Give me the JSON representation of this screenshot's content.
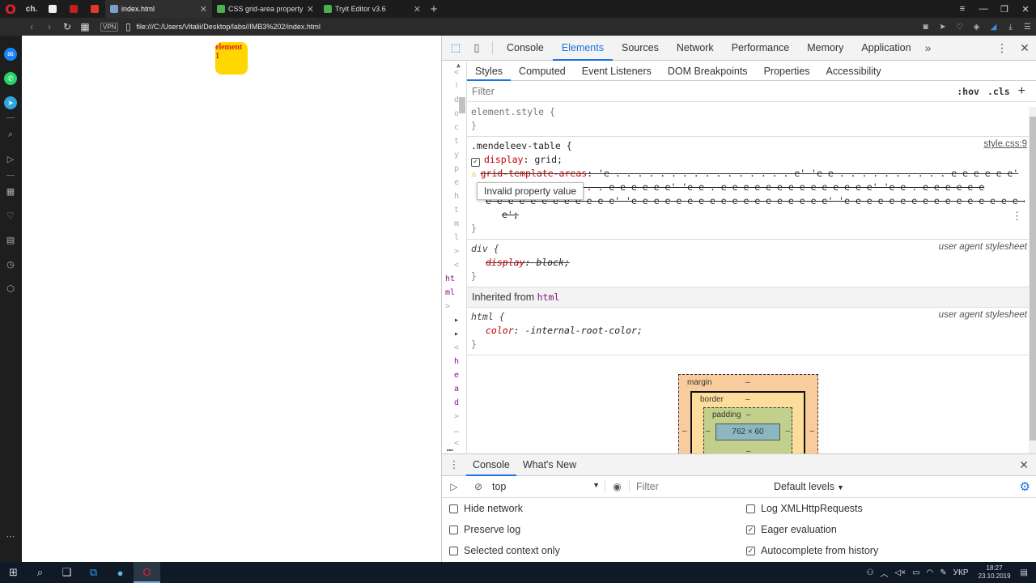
{
  "browser": {
    "pinned_tabs": [
      {
        "label": "ch."
      },
      {
        "label": ""
      },
      {
        "label": ""
      },
      {
        "label": ""
      }
    ],
    "tabs": [
      {
        "title": "index.html",
        "active": true,
        "favicon_color": "#7aa0c8"
      },
      {
        "title": "CSS grid-area property",
        "active": false,
        "favicon_color": "#4caf50"
      },
      {
        "title": "Tryit Editor v3.6",
        "active": false,
        "favicon_color": "#4caf50"
      }
    ],
    "vpn_label": "VPN",
    "url": "file:///C:/Users/Vitalii/Desktop/labs//IMB3%202/index.html"
  },
  "page": {
    "element_text": "element 1",
    "element_color": "#ffd700"
  },
  "devtools": {
    "tabs": [
      "Console",
      "Elements",
      "Sources",
      "Network",
      "Performance",
      "Memory",
      "Application"
    ],
    "active_tab": "Elements",
    "sub_tabs": [
      "Styles",
      "Computed",
      "Event Listeners",
      "DOM Breakpoints",
      "Properties",
      "Accessibility"
    ],
    "filter_placeholder": "Filter",
    "hov_label": ":hov",
    "cls_label": ".cls",
    "plus_label": "+",
    "left_gutter": {
      "chars": [
        "<",
        "!",
        "d",
        "o",
        "c",
        "t",
        "y",
        "p",
        "e",
        "h",
        "t",
        "m",
        "l",
        ">",
        "<"
      ],
      "html_lines": [
        "ht",
        "ml"
      ],
      "lower_chars": [
        ">",
        "▸",
        "▸",
        "<",
        "h",
        "e",
        "a",
        "d",
        ">"
      ],
      "bottom": [
        "…",
        "<",
        "/",
        "…"
      ]
    },
    "rules": {
      "element_style": {
        "selector": "element.style {",
        "close": "}"
      },
      "mendeleev": {
        "selector": ".mendeleev-table {",
        "source": "style.css:9",
        "display_prop": "display",
        "display_val": "grid;",
        "gta_prop": "grid-template-areas",
        "gta_line1": "'e . . . . . . . . . . . . . . . . e' 'e e . . . . . . . . . . e e e e e e'",
        "gta_line2": ". . . . . . . . . . . e e e e e e' 'e e . e e e e e e e e e e e e e e' 'e e . e e e e e e",
        "gta_line3": "e e e e e e e e e e e e' 'e e e e e e e e e e e e e e e e e e' 'e e e e e e e e e e e e e e e e e e",
        "gta_line4": "e';",
        "tooltip": "Invalid property value",
        "close": "}"
      },
      "div": {
        "selector": "div {",
        "source": "user agent stylesheet",
        "prop": "display",
        "val": "block;",
        "close": "}"
      },
      "inherited_label": "Inherited from",
      "inherited_tag": "html",
      "html": {
        "selector": "html {",
        "source": "user agent stylesheet",
        "prop": "color",
        "val": "-internal-root-color;",
        "close": "}"
      }
    },
    "box_model": {
      "margin_label": "margin",
      "border_label": "border",
      "padding_label": "padding",
      "content_size": "762 × 60",
      "dash": "–"
    },
    "drawer": {
      "tabs": [
        "Console",
        "What's New"
      ],
      "active_tab": "Console",
      "context": "top",
      "filter_placeholder": "Filter",
      "levels": "Default levels",
      "options_left": [
        {
          "label": "Hide network",
          "checked": false
        },
        {
          "label": "Preserve log",
          "checked": false
        },
        {
          "label": "Selected context only",
          "checked": false
        }
      ],
      "options_right": [
        {
          "label": "Log XMLHttpRequests",
          "checked": false
        },
        {
          "label": "Eager evaluation",
          "checked": true
        },
        {
          "label": "Autocomplete from history",
          "checked": true
        }
      ]
    }
  },
  "taskbar": {
    "lang": "УКР",
    "time": "18:27",
    "date": "23.10.2019"
  }
}
